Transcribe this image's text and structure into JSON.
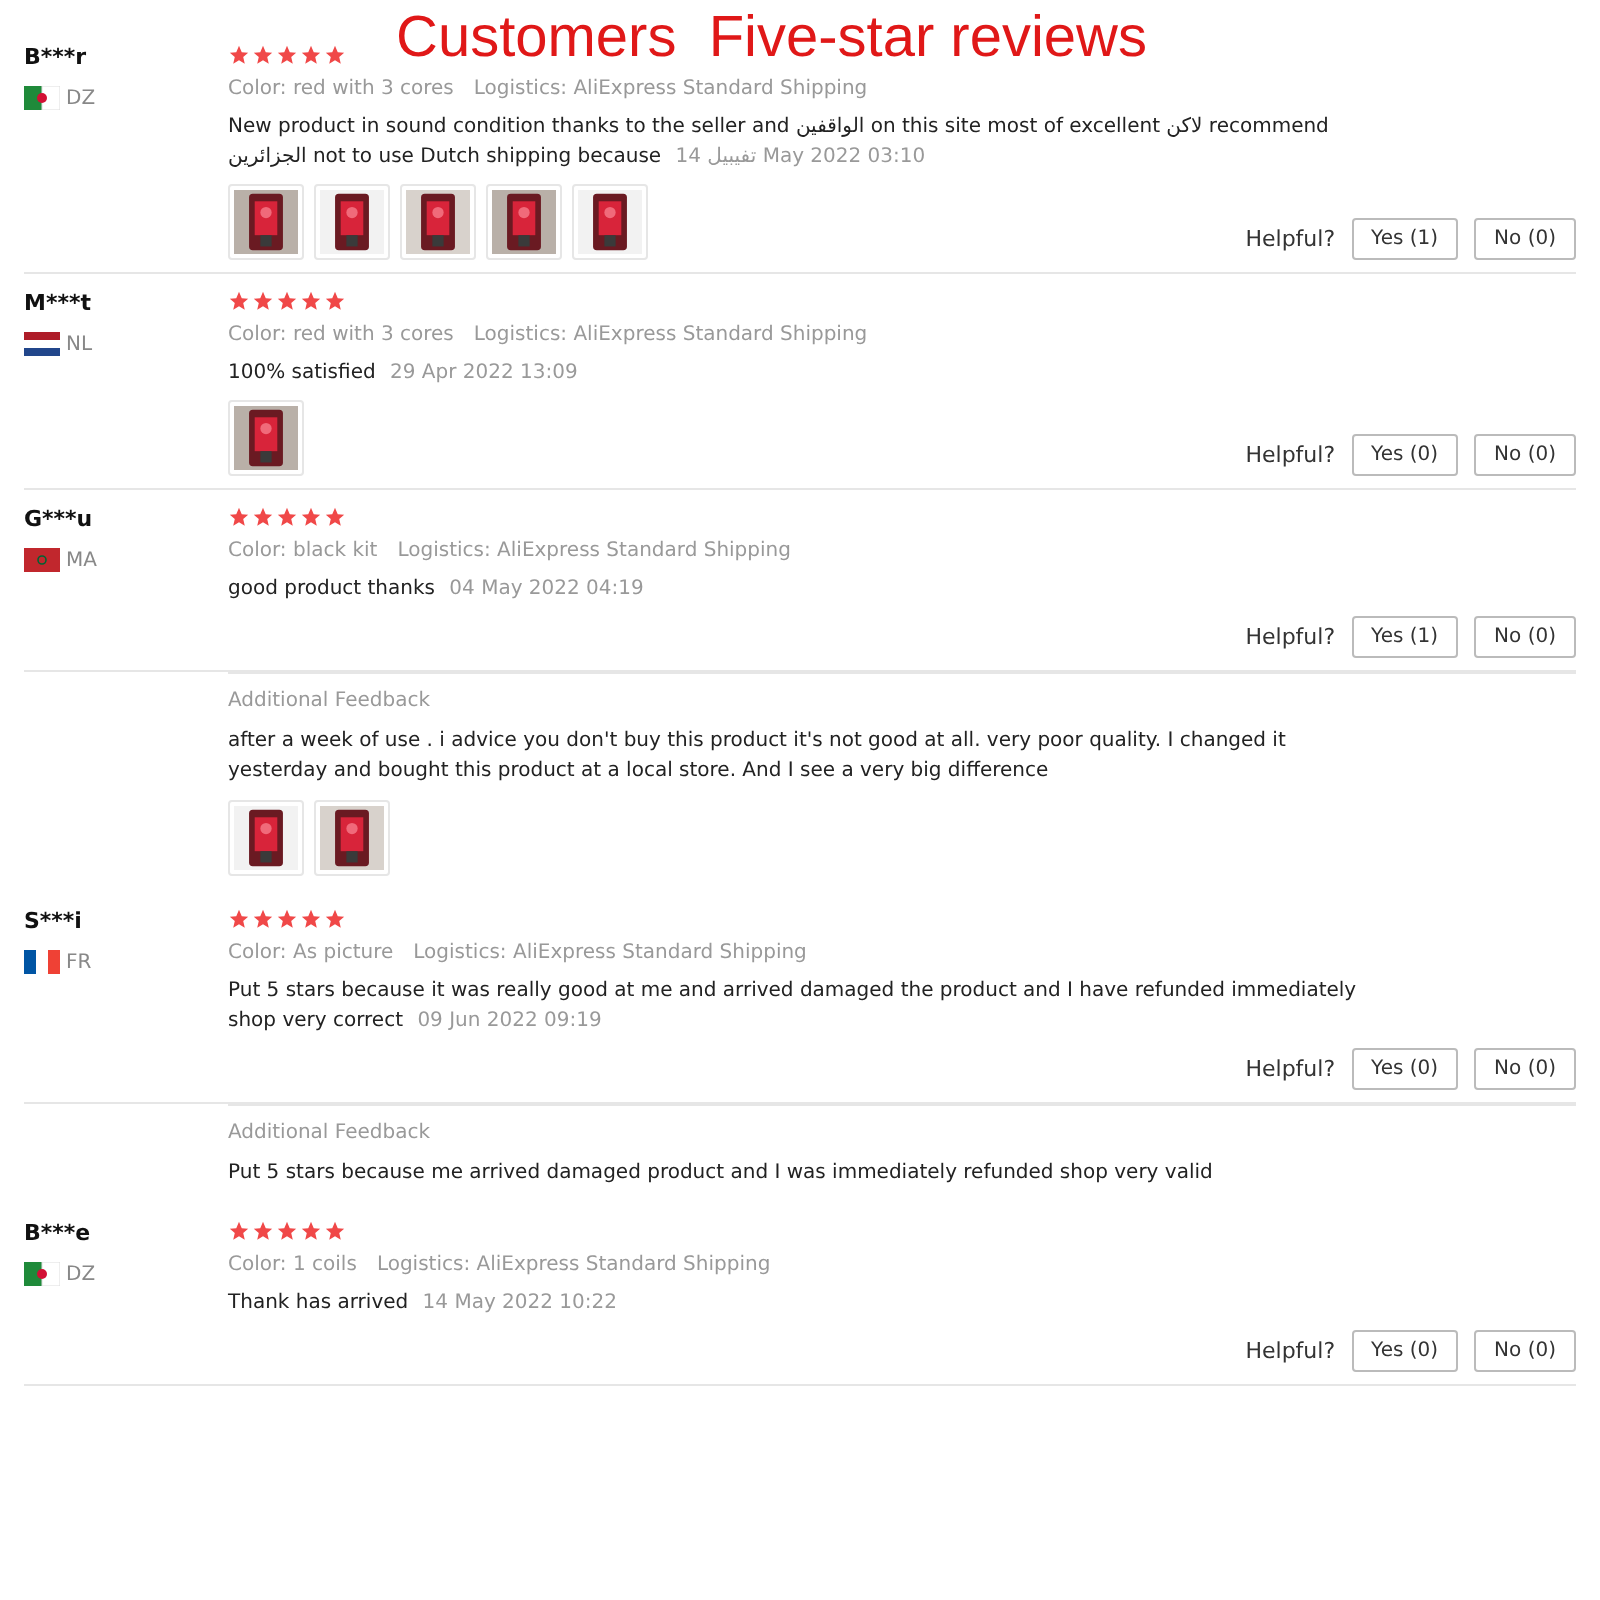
{
  "banner": "Customers  Five-star reviews",
  "reviews": [
    {
      "user": "B***r",
      "flag": {
        "kind": "algeria"
      },
      "country": "DZ",
      "stars": 5,
      "color_label": "Color:",
      "variant": "red with 3 cores",
      "logistics_label": "Logistics:",
      "logistics": "AliExpress Standard Shipping",
      "text": "New product in sound condition thanks to the seller and الواقفين on this site most of excellent لاكن recommend الجزائرين not to use Dutch shipping because",
      "date": "14 تفيبيل May 2022 03:10",
      "photos": [
        {
          "kind": "picture"
        },
        {
          "kind": "picture"
        },
        {
          "kind": "picture"
        },
        {
          "kind": "picture"
        },
        {
          "kind": "picture"
        }
      ],
      "helpful": "Helpful?",
      "yes": "Yes (1)",
      "no": "No (0)"
    },
    {
      "user": "M***t",
      "flag": {
        "kind": "netherlands"
      },
      "country": "NL",
      "stars": 5,
      "color_label": "Color:",
      "variant": "red with 3 cores",
      "logistics_label": "Logistics:",
      "logistics": "AliExpress Standard Shipping",
      "text": "100% satisfied",
      "date": "29 Apr 2022 13:09",
      "photos": [
        {
          "kind": "picture"
        }
      ],
      "helpful": "Helpful?",
      "yes": "Yes (0)",
      "no": "No (0)"
    },
    {
      "user": "G***u",
      "flag": {
        "kind": "morocco"
      },
      "country": "MA",
      "stars": 5,
      "color_label": "Color:",
      "variant": "black kit",
      "logistics_label": "Logistics:",
      "logistics": "AliExpress Standard Shipping",
      "text": "good product thanks",
      "date": "04 May 2022 04:19",
      "helpful": "Helpful?",
      "yes": "Yes (1)",
      "no": "No (0)",
      "additional": {
        "title": "Additional Feedback",
        "text": "after a week of use . i advice you don't buy this product it's not good at all. very poor quality. I changed it yesterday and bought this product at a local store. And I see a very big difference",
        "photos": [
          {
            "kind": "picture"
          },
          {
            "kind": "picture"
          }
        ]
      }
    },
    {
      "user": "S***i",
      "flag": {
        "kind": "france"
      },
      "country": "FR",
      "stars": 5,
      "color_label": "Color:",
      "variant": "As picture",
      "logistics_label": "Logistics:",
      "logistics": "AliExpress Standard Shipping",
      "text": "Put 5 stars because it was really good at me and arrived damaged the product and I have refunded immediately shop very correct",
      "date": "09 Jun 2022 09:19",
      "helpful": "Helpful?",
      "yes": "Yes (0)",
      "no": "No (0)",
      "additional": {
        "title": "Additional Feedback",
        "text": "Put 5 stars because me arrived damaged product and I was immediately refunded shop very valid"
      }
    },
    {
      "user": "B***e",
      "flag": {
        "kind": "algeria"
      },
      "country": "DZ",
      "stars": 5,
      "color_label": "Color:",
      "variant": "1 coils",
      "logistics_label": "Logistics:",
      "logistics": "AliExpress Standard Shipping",
      "text": "Thank has arrived",
      "date": "14 May 2022 10:22",
      "helpful": "Helpful?",
      "yes": "Yes (0)",
      "no": "No (0)"
    }
  ]
}
